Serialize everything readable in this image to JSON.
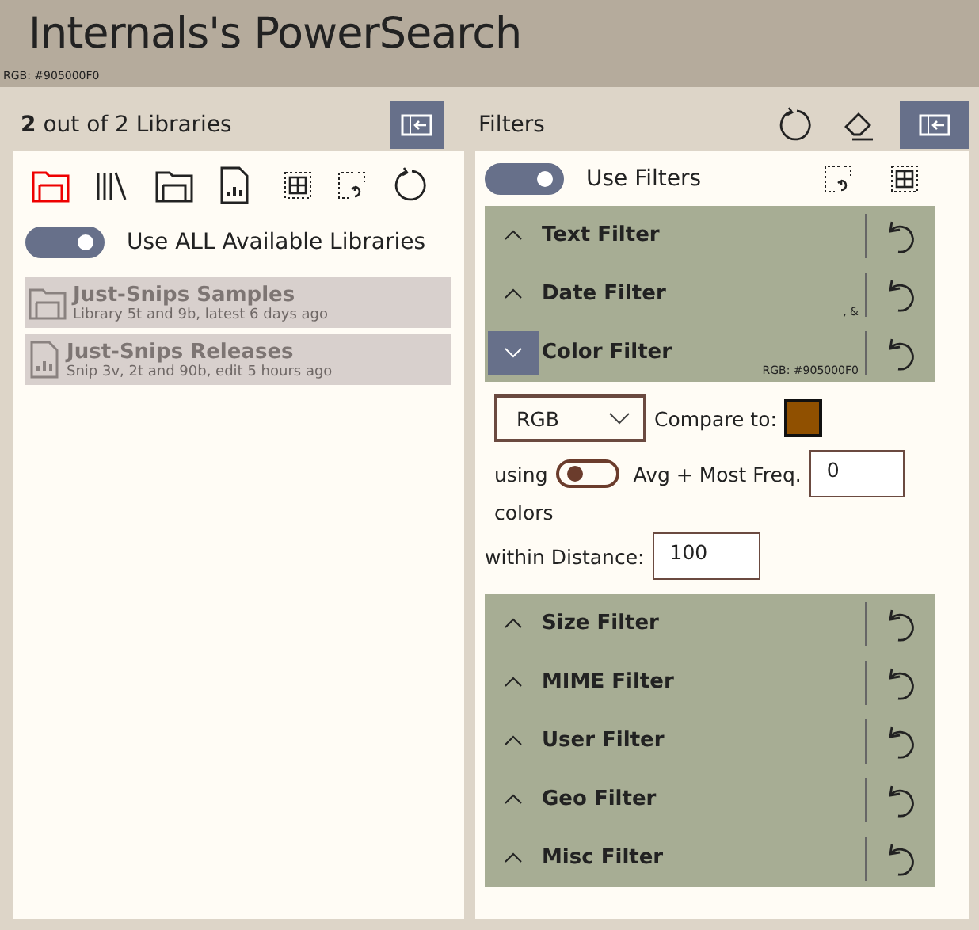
{
  "window": {
    "title": "Internals's PowerSearch",
    "subtitle": "RGB: #905000F0"
  },
  "libraries_panel": {
    "count": "2",
    "header": "out of 2 Libraries",
    "use_all": {
      "label": "Use ALL Available Libraries",
      "on": true
    },
    "libraries": [
      {
        "name": "Just-Snips Samples",
        "details": "Library 5t and 9b, latest 6 days ago",
        "kind": "folder",
        "disabled": true
      },
      {
        "name": "Just-Snips Releases",
        "details": "Snip 3v, 2t and 90b, edit 5 hours ago",
        "kind": "document",
        "disabled": true
      }
    ]
  },
  "filters_panel": {
    "header": "Filters",
    "use_filters": {
      "label": "Use Filters",
      "on": true
    },
    "filters": [
      {
        "name": "Text Filter",
        "expanded": false
      },
      {
        "name": "Date Filter",
        "expanded": false,
        "summary": ", &"
      },
      {
        "name": "Color Filter",
        "expanded": true,
        "summary": "RGB: #905000F0",
        "settings": {
          "mode": "RGB",
          "compare_label": "Compare to:",
          "color": "#905000",
          "using_label": "using",
          "using_on": false,
          "avg_label": "Avg + Most Freq.",
          "count": "0",
          "colors_label": "colors",
          "distance_label": "within Distance:",
          "distance": "100"
        }
      },
      {
        "name": "Size Filter",
        "expanded": false
      },
      {
        "name": "MIME Filter",
        "expanded": false
      },
      {
        "name": "User Filter",
        "expanded": false
      },
      {
        "name": "Geo Filter",
        "expanded": false
      },
      {
        "name": "Misc Filter",
        "expanded": false
      }
    ]
  }
}
